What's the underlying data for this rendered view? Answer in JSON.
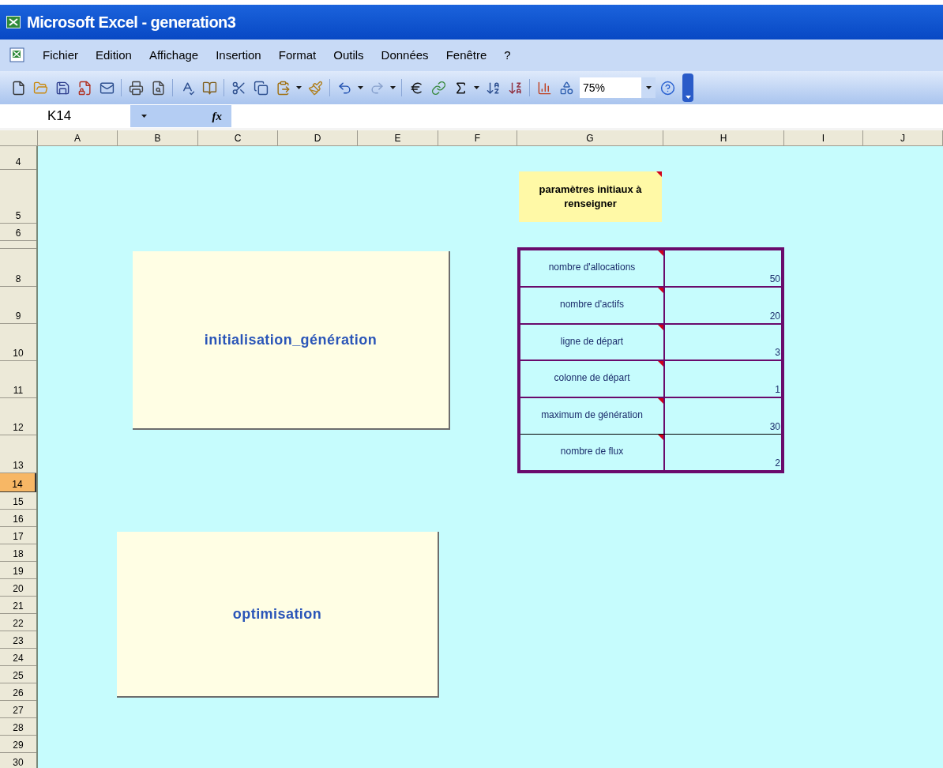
{
  "window": {
    "title": "Microsoft Excel - generation3"
  },
  "menu": [
    "Fichier",
    "Edition",
    "Affichage",
    "Insertion",
    "Format",
    "Outils",
    "Données",
    "Fenêtre",
    "?"
  ],
  "toolbar": {
    "zoom": "75%"
  },
  "formula_bar": {
    "name_box": "K14",
    "function_label": "fx"
  },
  "columns": [
    "A",
    "B",
    "C",
    "D",
    "E",
    "F",
    "G",
    "H",
    "I",
    "J"
  ],
  "rows": [
    {
      "label": "4",
      "selected": false
    },
    {
      "label": "5",
      "selected": false
    },
    {
      "label": "6",
      "selected": false
    },
    {
      "label": "8",
      "selected": false
    },
    {
      "label": "9",
      "selected": false
    },
    {
      "label": "10",
      "selected": false
    },
    {
      "label": "11",
      "selected": false
    },
    {
      "label": "12",
      "selected": false
    },
    {
      "label": "13",
      "selected": false
    },
    {
      "label": "14",
      "selected": true
    },
    {
      "label": "15",
      "selected": false
    },
    {
      "label": "16",
      "selected": false
    },
    {
      "label": "17",
      "selected": false
    },
    {
      "label": "18",
      "selected": false
    },
    {
      "label": "19",
      "selected": false
    },
    {
      "label": "20",
      "selected": false
    },
    {
      "label": "21",
      "selected": false
    },
    {
      "label": "22",
      "selected": false
    },
    {
      "label": "23",
      "selected": false
    },
    {
      "label": "24",
      "selected": false
    },
    {
      "label": "25",
      "selected": false
    },
    {
      "label": "26",
      "selected": false
    },
    {
      "label": "27",
      "selected": false
    },
    {
      "label": "28",
      "selected": false
    },
    {
      "label": "29",
      "selected": false
    },
    {
      "label": "30",
      "selected": false
    }
  ],
  "sheet": {
    "note": {
      "text": "paramètres initiaux à renseigner",
      "comment": true
    },
    "buttons": [
      "initialisation_génération",
      "optimisation"
    ],
    "parameters": [
      {
        "label": "nombre d'allocations",
        "value": "50",
        "comment": true
      },
      {
        "label": "nombre d'actifs",
        "value": "20",
        "comment": true
      },
      {
        "label": "ligne de départ",
        "value": "3",
        "comment": true
      },
      {
        "label": "colonne de départ",
        "value": "1",
        "comment": true
      },
      {
        "label": "maximum de génération",
        "value": "30",
        "comment": true
      },
      {
        "label": "nombre de flux",
        "value": "2",
        "comment": true
      }
    ]
  }
}
